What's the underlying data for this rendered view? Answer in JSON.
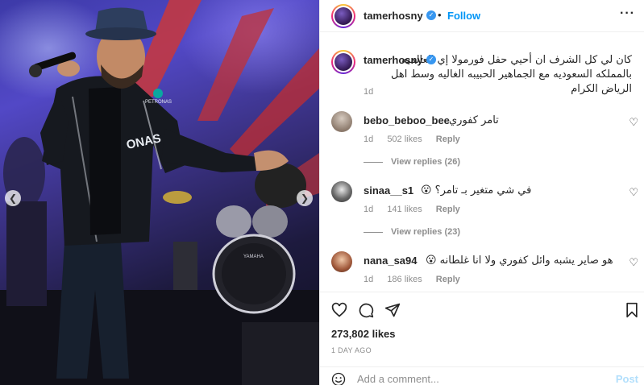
{
  "post": {
    "username": "tamerhosny",
    "follow_label": "Follow",
    "separator": "•",
    "more_label": "···"
  },
  "caption": {
    "username": "tamerhosny",
    "text": "كان لي كل الشرف ان أحيي حفل فورمولا إي العالميه بالمملكه السعوديه مع الجماهير الحبيبه الغاليه وسط اهل الرياض الكرام",
    "time": "1d"
  },
  "comments": [
    {
      "username": "bebo_beboo_bee",
      "text": "تامر كفوري",
      "time": "1d",
      "likes": "502 likes",
      "reply_label": "Reply",
      "view_replies": "View replies (26)"
    },
    {
      "username": "sinaa__s1",
      "text": "في شي متغير بـ تامر؟ 😮",
      "time": "1d",
      "likes": "141 likes",
      "reply_label": "Reply",
      "view_replies": "View replies (23)"
    },
    {
      "username": "nana_sa94",
      "text": "هو صاير يشبه وائل كفوري ولا انا غلطانه 😮",
      "time": "1d",
      "likes": "186 likes",
      "reply_label": "Reply"
    }
  ],
  "actions": {
    "likes_count": "273,802 likes",
    "posted_ago": "1 DAY AGO"
  },
  "add_comment": {
    "placeholder": "Add a comment...",
    "post_label": "Post"
  },
  "photo": {
    "jacket_text_1": "ONAS",
    "jacket_text_2": "PETRONAS",
    "drum_text": "YAMAHA"
  },
  "colors": {
    "accent": "#0095f6",
    "verified": "#3897f0",
    "muted": "#8e8e8e",
    "text": "#262626"
  }
}
